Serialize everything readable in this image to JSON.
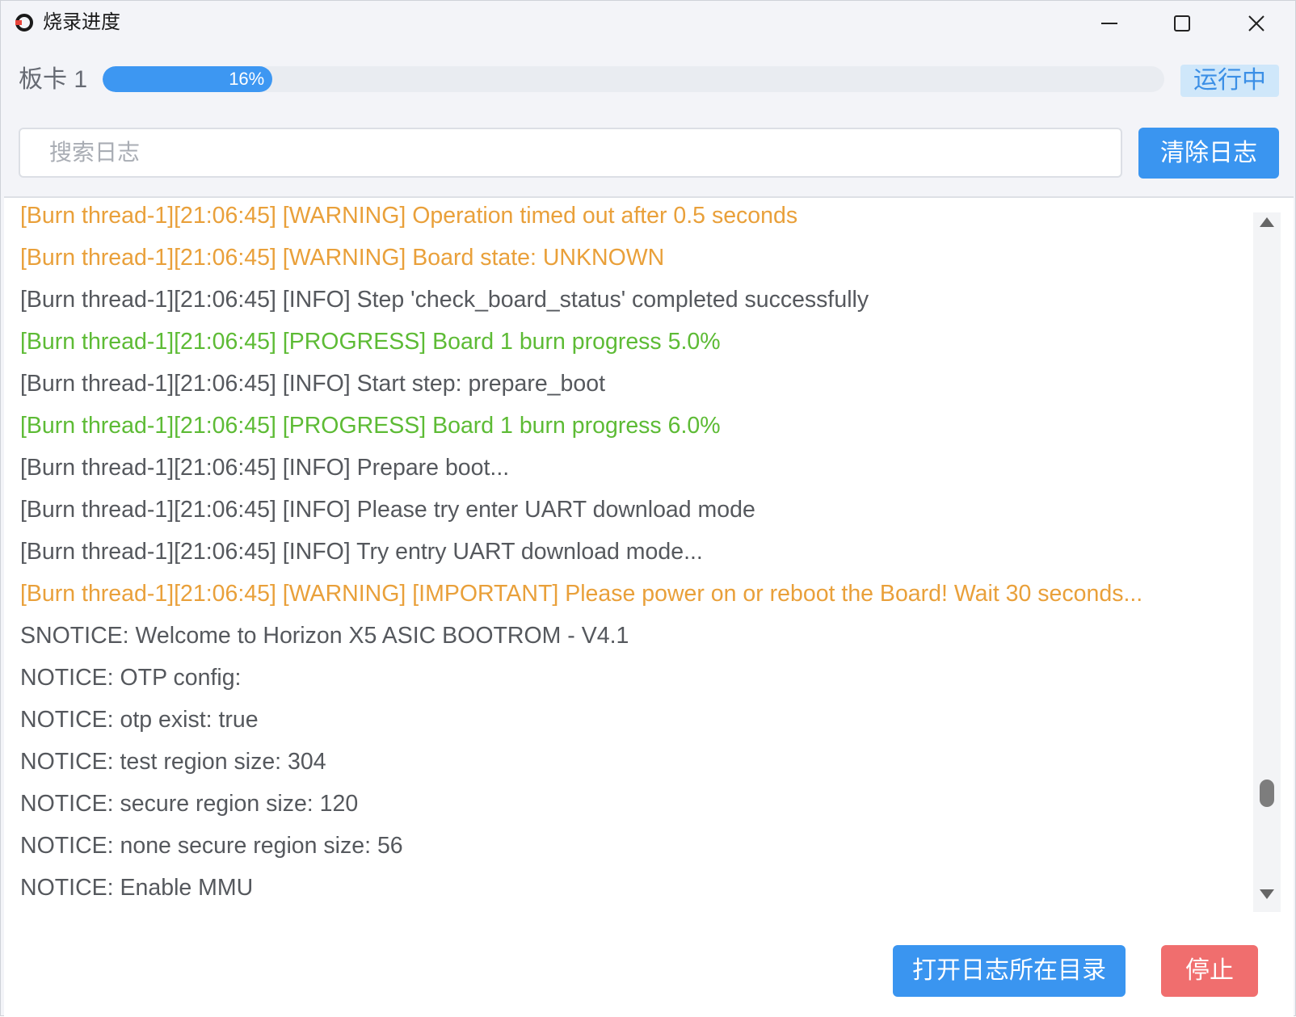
{
  "window": {
    "title": "烧录进度",
    "icon": "app-logo-icon",
    "controls": [
      "minimize-icon",
      "maximize-icon",
      "close-icon"
    ]
  },
  "board": {
    "label": "板卡 1",
    "progress_percent": 16,
    "progress_text": "16%",
    "status": "运行中"
  },
  "search": {
    "placeholder": "搜索日志",
    "value": "",
    "clear_label": "清除日志"
  },
  "log": {
    "lines": [
      {
        "level": "warning",
        "text": "[Burn thread-1][21:06:45] [WARNING] Operation timed out after 0.5 seconds"
      },
      {
        "level": "warning",
        "text": "[Burn thread-1][21:06:45] [WARNING] Board state: UNKNOWN"
      },
      {
        "level": "info",
        "text": "[Burn thread-1][21:06:45] [INFO] Step 'check_board_status' completed successfully"
      },
      {
        "level": "progress",
        "text": "[Burn thread-1][21:06:45] [PROGRESS] Board 1 burn progress 5.0%"
      },
      {
        "level": "info",
        "text": "[Burn thread-1][21:06:45] [INFO] Start step: prepare_boot"
      },
      {
        "level": "progress",
        "text": "[Burn thread-1][21:06:45] [PROGRESS] Board 1 burn progress 6.0%"
      },
      {
        "level": "info",
        "text": "[Burn thread-1][21:06:45] [INFO] Prepare boot..."
      },
      {
        "level": "info",
        "text": "[Burn thread-1][21:06:45] [INFO] Please try enter UART download mode"
      },
      {
        "level": "info",
        "text": "[Burn thread-1][21:06:45] [INFO] Try entry UART download mode..."
      },
      {
        "level": "warning",
        "text": "[Burn thread-1][21:06:45] [WARNING] [IMPORTANT] Please power on or reboot the Board! Wait 30 seconds..."
      },
      {
        "level": "info",
        "text": "SNOTICE: Welcome to Horizon X5 ASIC BOOTROM - V4.1"
      },
      {
        "level": "info",
        "text": "NOTICE: OTP config:"
      },
      {
        "level": "info",
        "text": "NOTICE: otp exist: true"
      },
      {
        "level": "info",
        "text": "NOTICE: test region size: 304"
      },
      {
        "level": "info",
        "text": "NOTICE: secure region size: 120"
      },
      {
        "level": "info",
        "text": "NOTICE: none secure region size: 56"
      },
      {
        "level": "info",
        "text": "NOTICE: Enable MMU"
      }
    ]
  },
  "footer": {
    "open_dir_label": "打开日志所在目录",
    "stop_label": "停止"
  },
  "colors": {
    "accent": "#3a95f0",
    "warning": "#e9a03a",
    "progress": "#5dbb35",
    "info": "#55585d",
    "danger": "#f06e6e",
    "status_bg": "#cfe7fa"
  }
}
